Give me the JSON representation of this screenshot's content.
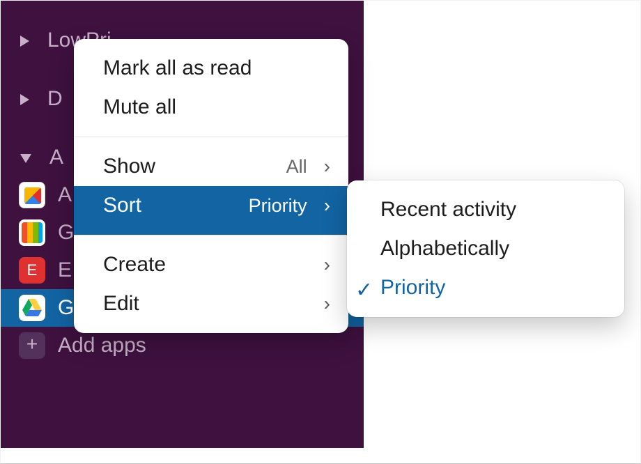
{
  "sidebar": {
    "sections": {
      "lowpri_label": "LowPri",
      "d_label": "D",
      "a_label": "A"
    },
    "apps": [
      {
        "label": "A"
      },
      {
        "label": "G"
      },
      {
        "label": "E"
      },
      {
        "label": "G"
      }
    ],
    "add_apps_label": "Add apps"
  },
  "context_menu": {
    "mark_all": "Mark all as read",
    "mute_all": "Mute all",
    "show_label": "Show",
    "show_value": "All",
    "sort_label": "Sort",
    "sort_value": "Priority",
    "create_label": "Create",
    "edit_label": "Edit"
  },
  "submenu": {
    "recent": "Recent activity",
    "alpha": "Alphabetically",
    "priority": "Priority"
  },
  "glyphs": {
    "chevron_right": "›",
    "check": "✓",
    "plus": "+"
  }
}
